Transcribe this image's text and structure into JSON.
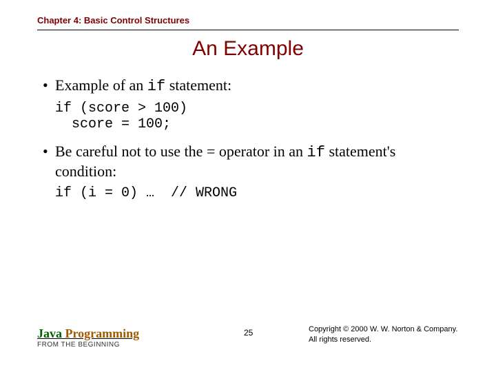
{
  "chapter": "Chapter 4: Basic Control Structures",
  "title": "An Example",
  "bullets": [
    {
      "pre": "Example of an ",
      "code": "if",
      "post": " statement:"
    },
    {
      "pre": "Be careful not to use the ",
      "eq": "=",
      "mid": " operator in an ",
      "code": "if",
      "post": " statement's condition:"
    }
  ],
  "code1_line1": "if (score > 100)",
  "code1_line2": "  score = 100;",
  "code2": "if (i = 0) …  // WRONG",
  "footer": {
    "book_word1": "Java",
    "book_word2": " Programming",
    "book_sub": "FROM THE BEGINNING",
    "page": "25",
    "copyright_line1": "Copyright © 2000 W. W. Norton & Company.",
    "copyright_line2": "All rights reserved."
  }
}
